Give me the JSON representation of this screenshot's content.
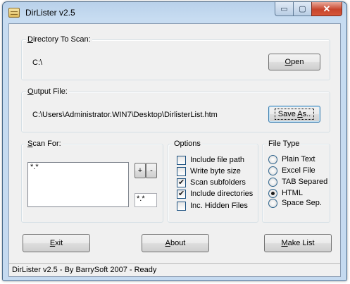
{
  "window": {
    "title": "DirLister v2.5",
    "caption_buttons": {
      "minimize": "▭",
      "maximize": "▢",
      "close": "✕"
    }
  },
  "directory_group": {
    "label_accel": "D",
    "label_rest": "irectory To Scan:",
    "path": "C:\\",
    "open_accel": "O",
    "open_rest": "pen"
  },
  "output_group": {
    "label_accel": "O",
    "label_rest": "utput File:",
    "path": "C:\\Users\\Administrator.WIN7\\Desktop\\DirlisterList.htm",
    "save_as_pre": "Save ",
    "save_as_accel": "A",
    "save_as_post": "s.."
  },
  "scan_for": {
    "label_accel": "S",
    "label_rest": "can For:",
    "list_items": [
      "*.*"
    ],
    "add_button": "+",
    "remove_button": "-",
    "pattern_value": "*.*"
  },
  "options": {
    "label": "Options",
    "items": [
      {
        "label": "Include file path",
        "checked": false
      },
      {
        "label": "Write byte size",
        "checked": false
      },
      {
        "label": "Scan subfolders",
        "checked": true
      },
      {
        "label": "Include directories",
        "checked": true
      },
      {
        "label": "Inc. Hidden Files",
        "checked": false
      }
    ]
  },
  "file_type": {
    "label": "File Type",
    "items": [
      {
        "label": "Plain Text",
        "selected": false
      },
      {
        "label": "Excel File",
        "selected": false
      },
      {
        "label": "TAB Separed",
        "selected": false
      },
      {
        "label": "HTML",
        "selected": true
      },
      {
        "label": "Space Sep.",
        "selected": false
      }
    ]
  },
  "actions": {
    "exit_accel": "E",
    "exit_rest": "xit",
    "about_accel": "A",
    "about_rest": "bout",
    "make_list_accel": "M",
    "make_list_rest": "ake List"
  },
  "status": "DirLister v2.5 - By BarrySoft 2007 - Ready",
  "colors": {
    "titlebar": "#b9d1ea",
    "client": "#f0f0f0",
    "close_button": "#c7452c"
  }
}
